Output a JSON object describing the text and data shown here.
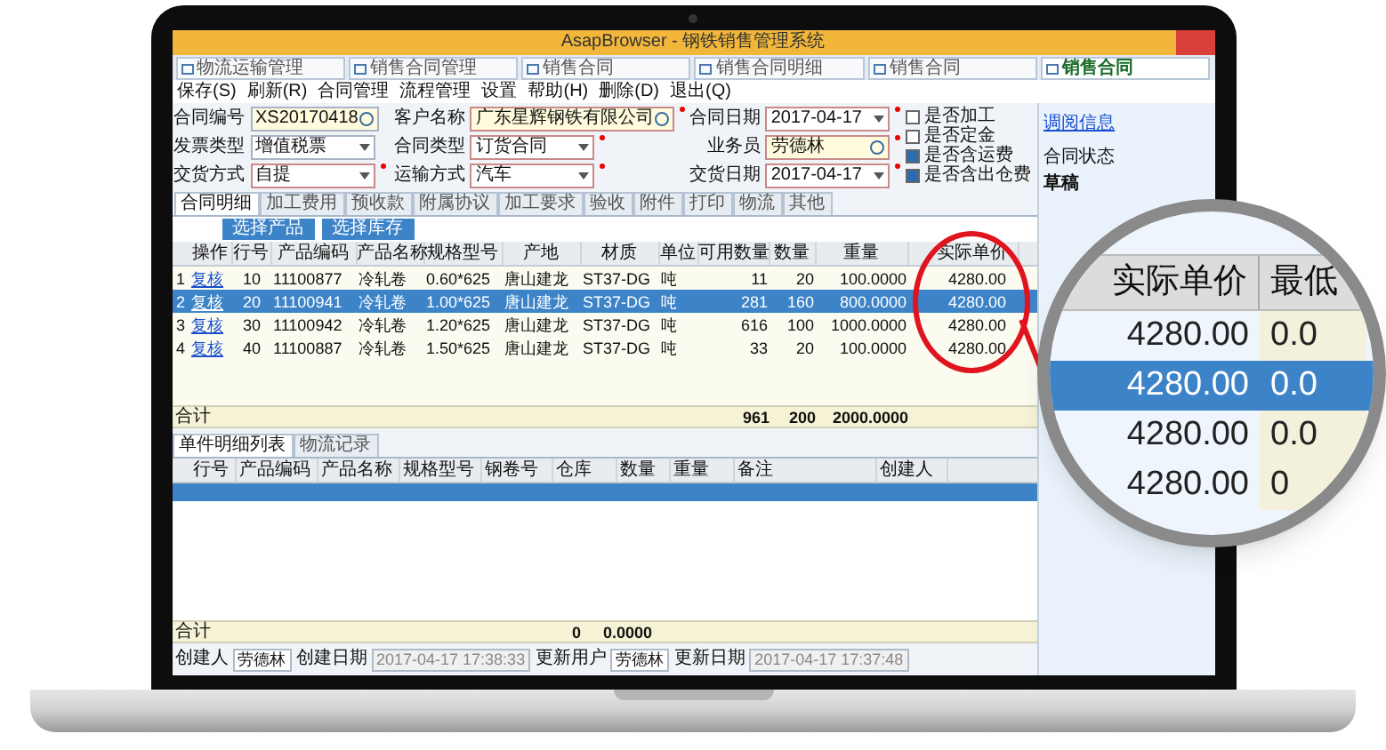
{
  "window": {
    "title": "AsapBrowser - 钢铁销售管理系统"
  },
  "browser_tabs": [
    {
      "label": "物流运输管理",
      "selected": false
    },
    {
      "label": "销售合同管理",
      "selected": false
    },
    {
      "label": "销售合同",
      "selected": false
    },
    {
      "label": "销售合同明细",
      "selected": false
    },
    {
      "label": "销售合同",
      "selected": false
    },
    {
      "label": "销售合同",
      "selected": true
    }
  ],
  "menu": [
    "保存(S)",
    "刷新(R)",
    "合同管理",
    "流程管理",
    "设置",
    "帮助(H)",
    "删除(D)",
    "退出(Q)"
  ],
  "form_fields": [
    {
      "label": "合同编号",
      "value": "XS20170418",
      "kind": "lookup",
      "required": false
    },
    {
      "label": "客户名称",
      "value": "广东星辉钢铁有限公司",
      "kind": "lookup",
      "required": true
    },
    {
      "label": "合同日期",
      "value": "2017-04-17",
      "kind": "select",
      "required": true
    },
    {
      "label": "发票类型",
      "value": "增值税票",
      "kind": "select",
      "required": false
    },
    {
      "label": "合同类型",
      "value": "订货合同",
      "kind": "select",
      "required": true
    },
    {
      "label": "业务员",
      "value": "劳德林",
      "kind": "lookup",
      "required": true
    },
    {
      "label": "交货方式",
      "value": "自提",
      "kind": "select",
      "required": true
    },
    {
      "label": "运输方式",
      "value": "汽车",
      "kind": "select",
      "required": true
    },
    {
      "label": "交货日期",
      "value": "2017-04-17",
      "kind": "select",
      "required": true
    }
  ],
  "options": [
    {
      "label": "是否加工",
      "checked": false
    },
    {
      "label": "是否定金",
      "checked": false
    },
    {
      "label": "是否含运费",
      "checked": true
    },
    {
      "label": "是否含出仓费",
      "checked": true
    }
  ],
  "detail_tabs": [
    {
      "label": "合同明细",
      "selected": true
    },
    {
      "label": "加工费用",
      "selected": false
    },
    {
      "label": "预收款",
      "selected": false
    },
    {
      "label": "附属协议",
      "selected": false
    },
    {
      "label": "加工要求",
      "selected": false
    },
    {
      "label": "验收",
      "selected": false
    },
    {
      "label": "附件",
      "selected": false
    },
    {
      "label": "打印",
      "selected": false
    },
    {
      "label": "物流",
      "selected": false
    },
    {
      "label": "其他",
      "selected": false
    }
  ],
  "grid_buttons": [
    "选择产品",
    "选择库存"
  ],
  "grid": {
    "columns": [
      "操作",
      "行号",
      "产品编码",
      "产品名称",
      "规格型号",
      "产地",
      "材质",
      "单位",
      "可用数量",
      "数量",
      "重量",
      "实际单价"
    ],
    "rows": [
      {
        "selected": false,
        "number": "1",
        "cells": [
          "复核",
          "10",
          "11100877",
          "冷轧卷",
          "0.60*625",
          "唐山建龙",
          "ST37-DG",
          "吨",
          "11",
          "20",
          "100.0000",
          "4280.00"
        ]
      },
      {
        "selected": true,
        "number": "2",
        "cells": [
          "复核",
          "20",
          "11100941",
          "冷轧卷",
          "1.00*625",
          "唐山建龙",
          "ST37-DG",
          "吨",
          "281",
          "160",
          "800.0000",
          "4280.00"
        ]
      },
      {
        "selected": false,
        "number": "3",
        "cells": [
          "复核",
          "30",
          "11100942",
          "冷轧卷",
          "1.20*625",
          "唐山建龙",
          "ST37-DG",
          "吨",
          "616",
          "100",
          "1000.0000",
          "4280.00"
        ]
      },
      {
        "selected": false,
        "number": "4",
        "cells": [
          "复核",
          "40",
          "11100887",
          "冷轧卷",
          "1.50*625",
          "唐山建龙",
          "ST37-DG",
          "吨",
          "33",
          "20",
          "100.0000",
          "4280.00"
        ]
      }
    ],
    "total_label": "合计",
    "totals": [
      "961",
      "200",
      "2000.0000"
    ]
  },
  "bottom_tabs": [
    {
      "label": "单件明细列表",
      "selected": true
    },
    {
      "label": "物流记录",
      "selected": false
    }
  ],
  "bottom_grid": {
    "columns": [
      "行号",
      "产品编码",
      "产品名称",
      "规格型号",
      "钢卷号",
      "仓库",
      "数量",
      "重量",
      "备注",
      "创建人"
    ],
    "total_label": "合计",
    "totals": [
      "0",
      "0.0000"
    ]
  },
  "footer": [
    {
      "label": "创建人",
      "value": "劳德林",
      "disabled": false
    },
    {
      "label": "创建日期",
      "value": "2017-04-17 17:38:33",
      "disabled": true
    },
    {
      "label": "更新用户",
      "value": "劳德林",
      "disabled": false
    },
    {
      "label": "更新日期",
      "value": "2017-04-17 17:37:48",
      "disabled": true
    }
  ],
  "side_panel": {
    "link": "调阅信息",
    "status_label": "合同状态",
    "status": "草稿"
  },
  "magnifier": {
    "columns": [
      "实际单价",
      "最低"
    ],
    "rows": [
      {
        "selected": false,
        "cells": [
          "4280.00",
          "0.0"
        ]
      },
      {
        "selected": true,
        "cells": [
          "4280.00",
          "0.0"
        ]
      },
      {
        "selected": false,
        "cells": [
          "4280.00",
          "0.0"
        ]
      },
      {
        "selected": false,
        "cells": [
          "4280.00",
          "0"
        ]
      }
    ]
  }
}
